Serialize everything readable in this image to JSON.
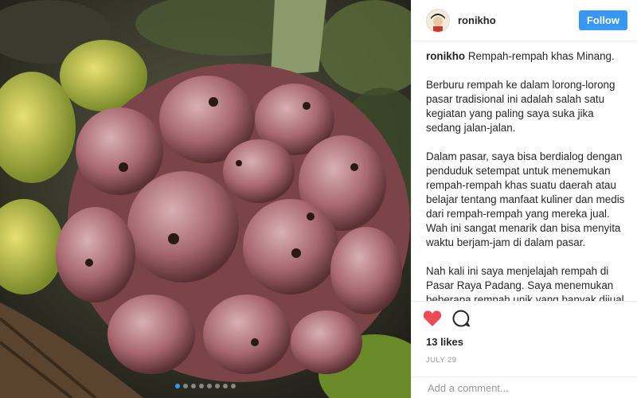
{
  "header": {
    "username": "ronikho",
    "follow_label": "Follow"
  },
  "caption": {
    "username": "ronikho",
    "paragraphs": [
      "Rempah-rempah khas Minang.",
      "Berburu rempah ke dalam lorong-lorong pasar tradisional ini adalah salah satu kegiatan yang paling saya suka jika sedang jalan-jalan.",
      "Dalam pasar, saya bisa berdialog dengan penduduk setempat untuk menemukan rempah-rempah khas suatu daerah atau belajar tentang manfaat kuliner dan medis dari rempah-rempah yang mereka jual. Wah ini sangat menarik dan bisa menyita waktu berjam-jam di dalam pasar.",
      "Nah kali ini saya menjelajah rempah di Pasar Raya Padang. Saya menemukan beberapa rempah unik yang banyak dijual di pasar ini. Ada asam cikala, asam kandis, daun ruku-ruku, kacang rendang, jeruk"
    ]
  },
  "stats": {
    "likes": "13 likes",
    "date": "JULY 29"
  },
  "comment": {
    "placeholder": "Add a comment..."
  },
  "carousel": {
    "count": 8,
    "active_index": 0
  },
  "colors": {
    "accent": "#3897f0",
    "heart": "#ed4956"
  },
  "icons": {
    "like": "heart-filled-icon",
    "comment": "speech-bubble-icon"
  }
}
